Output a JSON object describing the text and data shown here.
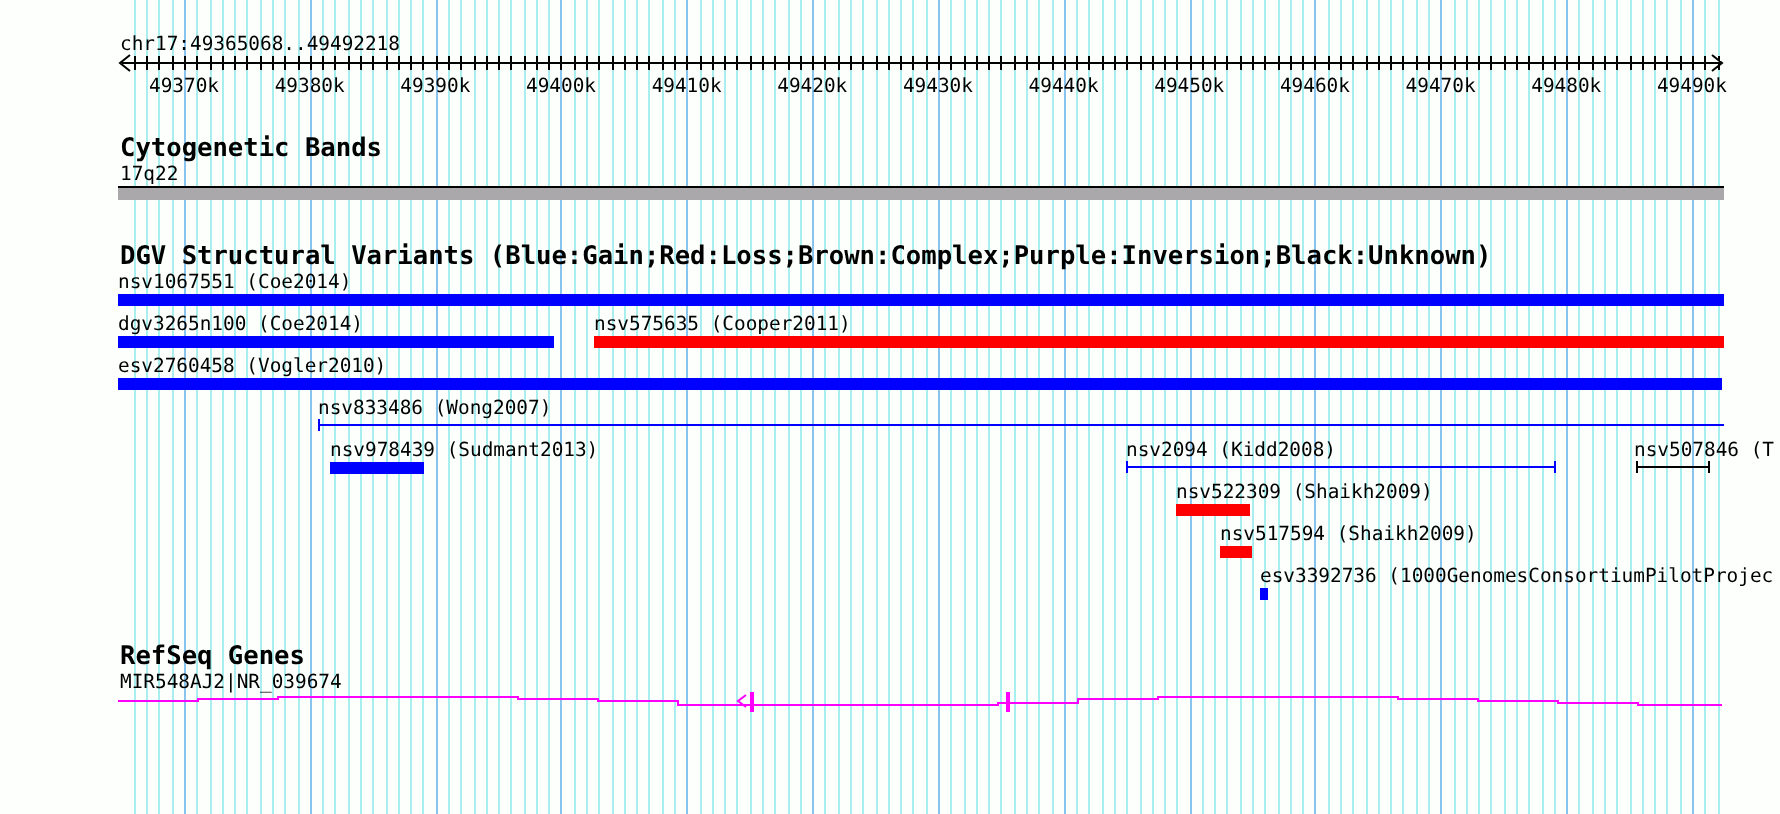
{
  "position": "chr17:49365068..49492218",
  "ruler": {
    "ticks": [
      "49370k",
      "49380k",
      "49390k",
      "49400k",
      "49410k",
      "49420k",
      "49430k",
      "49440k",
      "49450k",
      "49460k",
      "49470k",
      "49480k",
      "49490k"
    ]
  },
  "tracks": [
    {
      "kind": "cyto",
      "title": "Cytogenetic Bands",
      "features": [
        {
          "label": "17q22",
          "color": "#aaa8aa"
        }
      ]
    },
    {
      "kind": "dgv",
      "title": "DGV Structural Variants (Blue:Gain;Red:Loss;Brown:Complex;Purple:Inversion;Black:Unknown)",
      "features": [
        {
          "label": "nsv1067551 (Coe2014)",
          "kind": "bar",
          "color": "#0000ff"
        },
        {
          "label": "dgv3265n100 (Coe2014)",
          "kind": "bar",
          "color": "#0000ff"
        },
        {
          "label": "nsv575635 (Cooper2011)",
          "kind": "bar",
          "color": "#ff0000"
        },
        {
          "label": "esv2760458 (Vogler2010)",
          "kind": "bar",
          "color": "#0000ff"
        },
        {
          "label": "nsv833486 (Wong2007)",
          "kind": "span",
          "color": "#0000ff"
        },
        {
          "label": "nsv978439 (Sudmant2013)",
          "kind": "bar",
          "color": "#0000ff"
        },
        {
          "label": "nsv2094 (Kidd2008)",
          "kind": "span",
          "color": "#0000ff"
        },
        {
          "label": "nsv507846 (T",
          "kind": "span",
          "color": "#000000"
        },
        {
          "label": "nsv522309 (Shaikh2009)",
          "kind": "bar",
          "color": "#ff0000"
        },
        {
          "label": "nsv517594 (Shaikh2009)",
          "kind": "bar",
          "color": "#ff0000"
        },
        {
          "label": "esv3392736 (1000GenomesConsortiumPilotProjec",
          "kind": "bar",
          "color": "#0000ff"
        }
      ]
    },
    {
      "kind": "gene",
      "title": "RefSeq Genes",
      "features": [
        {
          "label": "MIR548AJ2|NR_039674",
          "color": "#ff00ff"
        }
      ]
    }
  ]
}
